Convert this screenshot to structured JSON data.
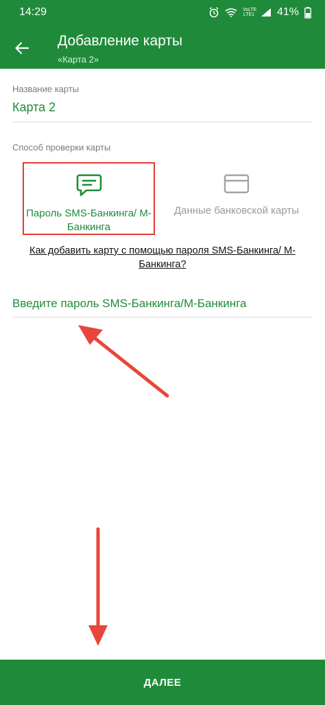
{
  "status_bar": {
    "time": "14:29",
    "network": "VoLTE LTE1",
    "battery": "41%"
  },
  "app_bar": {
    "title": "Добавление карты",
    "subtitle": "«Карта 2»",
    "back_icon": "arrow-left-icon"
  },
  "card_name": {
    "label": "Название карты",
    "value": "Карта 2"
  },
  "verification": {
    "label": "Способ проверки карты",
    "options": [
      {
        "label": "Пароль SMS-Банкинга/ М-Банкинга",
        "icon": "sms-chat-icon",
        "selected": true
      },
      {
        "label": "Данные банковской карты",
        "icon": "credit-card-icon",
        "selected": false
      }
    ]
  },
  "help_link": "Как добавить карту с помощью пароля SMS-Банкинга/ М-Банкинга?",
  "password_field": {
    "placeholder": "Введите пароль SMS-Банкинга/М-Банкинга",
    "value": ""
  },
  "next_button": "ДАЛЕЕ",
  "colors": {
    "brand_green": "#1f8b3a",
    "highlight_red": "#e53935",
    "annotation_arrow": "#e8463a"
  }
}
